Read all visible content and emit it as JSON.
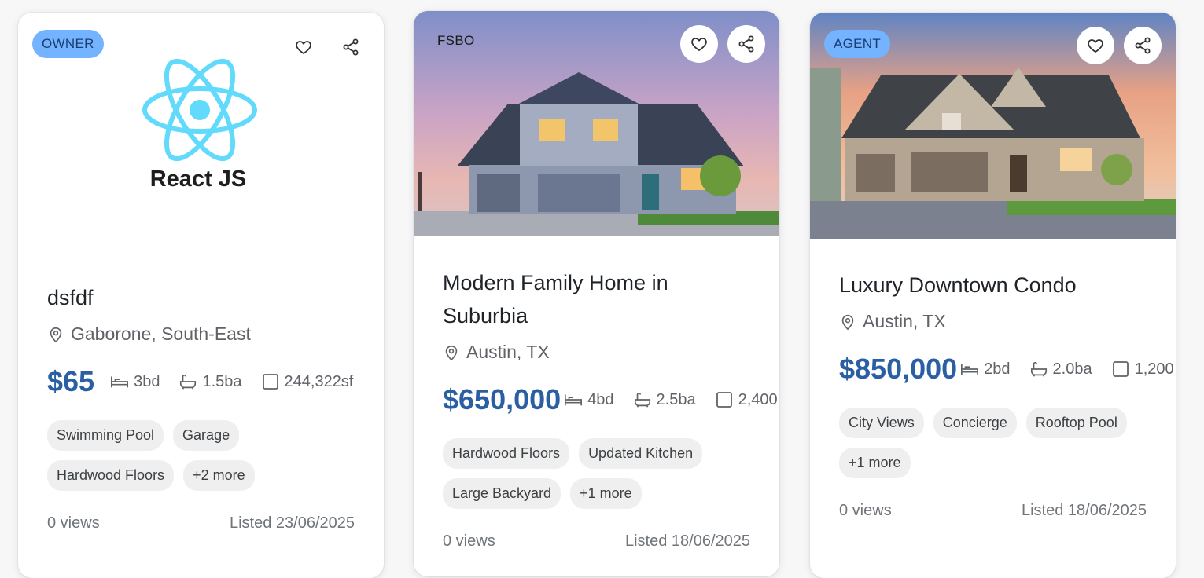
{
  "listings": [
    {
      "badge": "OWNER",
      "logo_text": "React JS",
      "title": "dsfdf",
      "location": "Gaborone, South-East",
      "price": "$65",
      "beds": "3bd",
      "baths": "1.5ba",
      "area": "244,322sf",
      "tags": [
        "Swimming Pool",
        "Garage",
        "Hardwood Floors",
        "+2 more"
      ],
      "views": "0 views",
      "listed": "Listed 23/06/2025"
    },
    {
      "badge": "FSBO",
      "title": "Modern Family Home in Suburbia",
      "location": "Austin, TX",
      "price": "$650,000",
      "beds": "4bd",
      "baths": "2.5ba",
      "area": "2,400",
      "tags": [
        "Hardwood Floors",
        "Updated Kitchen",
        "Large Backyard",
        "+1 more"
      ],
      "views": "0 views",
      "listed": "Listed 18/06/2025"
    },
    {
      "badge": "AGENT",
      "title": "Luxury Downtown Condo",
      "location": "Austin, TX",
      "price": "$850,000",
      "beds": "2bd",
      "baths": "2.0ba",
      "area": "1,200",
      "tags": [
        "City Views",
        "Concierge",
        "Rooftop Pool",
        "+1 more"
      ],
      "views": "0 views",
      "listed": "Listed 18/06/2025"
    }
  ],
  "icons": {
    "favorite": "heart-icon",
    "share": "share-icon",
    "location": "location-pin-icon",
    "beds": "bed-icon",
    "baths": "bathtub-icon",
    "area": "square-area-icon"
  },
  "colors": {
    "price": "#2b5fa3",
    "badge_bg": "#74b3ff",
    "badge_text": "#1a3e72",
    "react_blue": "#61dafb"
  }
}
